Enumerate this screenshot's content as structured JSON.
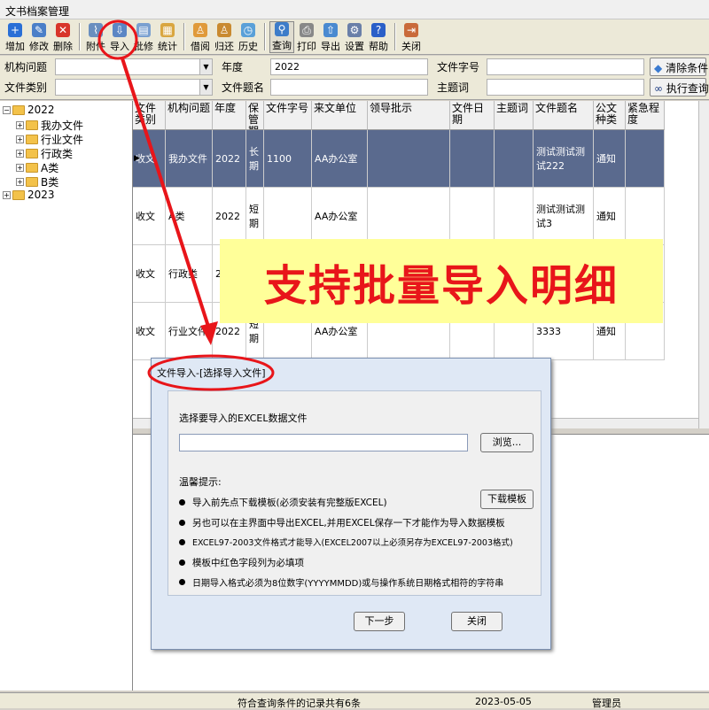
{
  "app_title": "文书档案管理",
  "toolbar": {
    "buttons": [
      "增加",
      "修改",
      "删除",
      "附件",
      "导入",
      "批修",
      "统计",
      "借阅",
      "归还",
      "历史",
      "查询",
      "打印",
      "导出",
      "设置",
      "帮助",
      "关闭"
    ]
  },
  "filters": {
    "org_label": "机构问题",
    "year_label": "年度",
    "year_value": "2022",
    "docno_label": "文件字号",
    "type_label": "文件类别",
    "doctitle_label": "文件题名",
    "subject_label": "主题词",
    "clear_btn": "清除条件",
    "exec_btn": "执行查询"
  },
  "tree": {
    "root1": "2022",
    "children": [
      "我办文件",
      "行业文件",
      "行政类",
      "A类",
      "B类"
    ],
    "root2": "2023"
  },
  "grid": {
    "headers": [
      "文件类别",
      "机构问题",
      "年度",
      "保管期限",
      "文件字号",
      "来文单位",
      "领导批示",
      "文件日期",
      "主题词",
      "文件题名",
      "公文种类",
      "紧急程度"
    ],
    "rows": [
      [
        "收文",
        "我办文件",
        "2022",
        "长期",
        "1100",
        "AA办公室",
        "",
        "",
        "",
        "测试测试测试222",
        "通知",
        ""
      ],
      [
        "收文",
        "A类",
        "2022",
        "短期",
        "",
        "AA办公室",
        "",
        "",
        "",
        "测试测试测试3",
        "通知",
        ""
      ],
      [
        "收文",
        "行政类",
        "2",
        "",
        "",
        "",
        "",
        "",
        "",
        "",
        "",
        ""
      ],
      [
        "收文",
        "行业文件",
        "2022",
        "短期",
        "",
        "AA办公室",
        "",
        "",
        "",
        "3333",
        "通知",
        ""
      ]
    ]
  },
  "banner_text": "支持批量导入明细",
  "dialog": {
    "title": "文件导入-[选择导入文件]",
    "select_label": "选择要导入的EXCEL数据文件",
    "file_value": "",
    "browse_btn": "浏览...",
    "tips_title": "温馨提示:",
    "download_btn": "下载模板",
    "tips": [
      "导入前先点下载模板(必须安装有完整版EXCEL)",
      "另也可以在主界面中导出EXCEL,并用EXCEL保存一下才能作为导入数据模板",
      "EXCEL97-2003文件格式才能导入(EXCEL2007以上必须另存为EXCEL97-2003格式)",
      "模板中红色字段列为必填项",
      "日期导入格式必须为8位数字(YYYYMMDD)或与操作系统日期格式相符的字符串"
    ],
    "next_btn": "下一步",
    "close_btn": "关闭"
  },
  "status": {
    "records": "符合查询条件的记录共有6条",
    "date": "2023-05-05",
    "user": "管理员"
  },
  "colors": {
    "annotation_red": "#e8151a",
    "highlight_row": "#5a6a8e",
    "banner_bg": "#ffff99"
  }
}
